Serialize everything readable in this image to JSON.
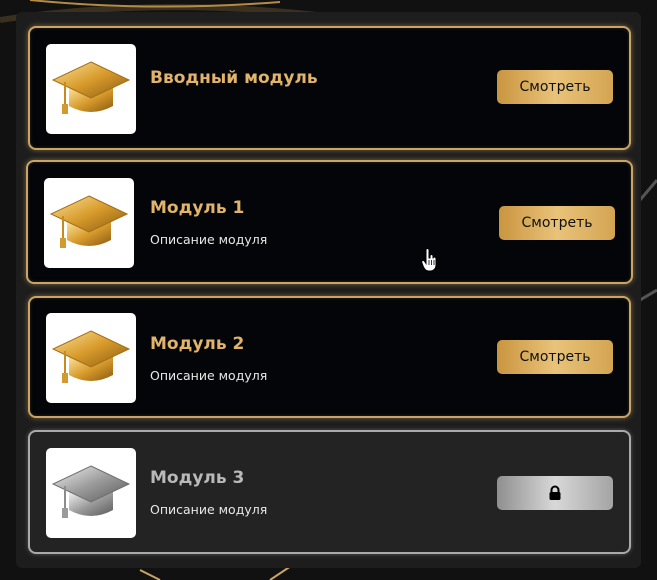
{
  "modules": [
    {
      "title": "Вводный модуль",
      "description": "",
      "button_label": "Смотреть",
      "locked": false
    },
    {
      "title": "Модуль 1",
      "description": "Описание модуля",
      "button_label": "Смотреть",
      "locked": false
    },
    {
      "title": "Модуль 2",
      "description": "Описание модуля",
      "button_label": "Смотреть",
      "locked": false
    },
    {
      "title": "Модуль 3",
      "description": "Описание модуля",
      "button_label": "",
      "locked": true
    }
  ],
  "icons": {
    "thumbnail": "graduation-cap-icon",
    "locked_button": "lock-icon",
    "pointer": "hand-pointer-icon"
  },
  "colors": {
    "gold_accent": "#e2b36a",
    "gold_border": "#c9a464",
    "card_bg": "#030508",
    "locked_card_bg": "#232323",
    "panel_bg": "#1d1d1d"
  }
}
